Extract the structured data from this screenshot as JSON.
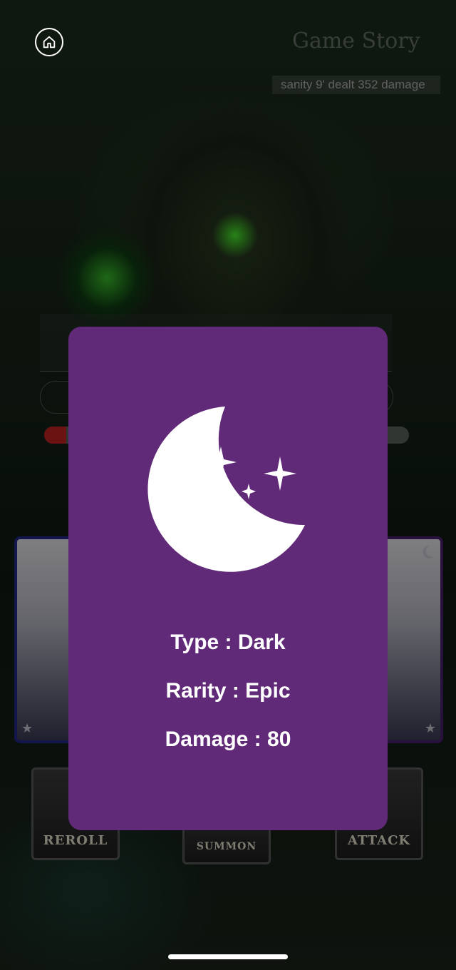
{
  "background": {
    "story_title": "Game Story",
    "story_line": "sanity 9' dealt 352 damage",
    "hp_fraction": 0.06
  },
  "buttons": {
    "reroll_label": "REROLL",
    "summon_label": "SUMMON",
    "attack_label": "ATTACK"
  },
  "modal": {
    "icon": "moon-stars-icon",
    "type_text": "Type : Dark",
    "rarity_text": "Rarity : Epic",
    "damage_text": "Damage : 80"
  },
  "colors": {
    "modal_bg": "#612a78",
    "card_left_border": "#22298c",
    "card_right_border": "#4a1f6e",
    "hp_fill": "#c32424"
  }
}
